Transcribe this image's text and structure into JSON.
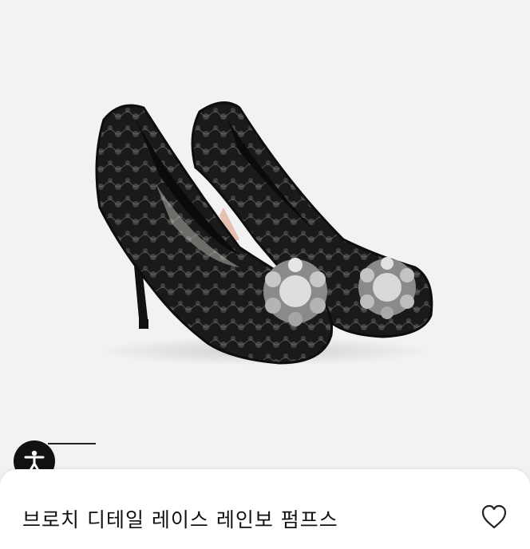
{
  "product": {
    "title": "브로치 디테일 레이스 레인보 펌프스",
    "image_alt": "black lace pumps with crystal brooch"
  },
  "accessibility": {
    "icon": "accessibility-icon"
  },
  "actions": {
    "favorite_icon": "heart-icon"
  },
  "colors": {
    "background": "#f2f2f2",
    "sheet": "#ffffff",
    "text": "#111111"
  }
}
